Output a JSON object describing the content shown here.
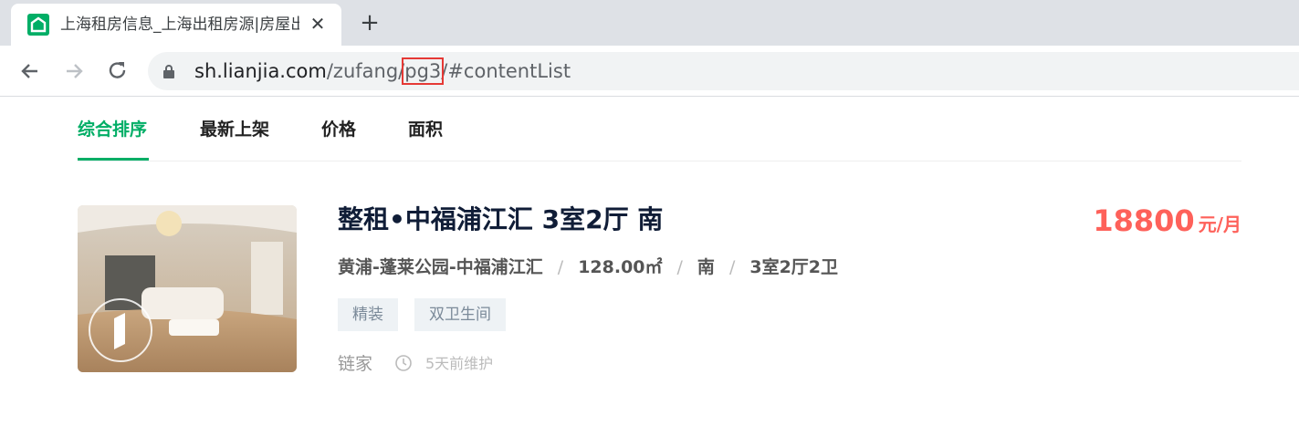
{
  "browser": {
    "tab_title": "上海租房信息_上海出租房源|房屋出租价格",
    "tab_close": "✕",
    "new_tab": "+",
    "url_host": "sh.lianjia.com",
    "url_path_before": "/zufang/",
    "url_path_highlight": "pg3",
    "url_path_after": "/#contentList"
  },
  "sort_tabs": [
    "综合排序",
    "最新上架",
    "价格",
    "面积"
  ],
  "listing": {
    "title": "整租•中福浦江汇 3室2厅 南",
    "price": "18800",
    "price_unit": "元/月",
    "location": "黄浦-蓬莱公园-中福浦江汇",
    "area": "128.00㎡",
    "orientation": "南",
    "layout": "3室2厅2卫",
    "separator": "/",
    "tags": [
      "精装",
      "双卫生间"
    ],
    "brand": "链家",
    "maintenance": "5天前维护"
  },
  "colors": {
    "brand_green": "#00ae66",
    "price_red": "#fe615a",
    "url_highlight": "#e53935"
  }
}
